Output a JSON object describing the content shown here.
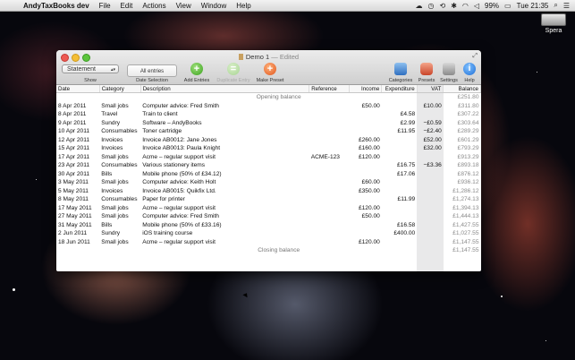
{
  "menubar": {
    "app_name": "AndyTaxBooks dev",
    "items": [
      "File",
      "Edit",
      "Actions",
      "View",
      "Window",
      "Help"
    ],
    "battery": "99%",
    "clock": "Tue 21:35"
  },
  "desktop": {
    "drive_label": "Spera"
  },
  "window": {
    "title": "Demo 1",
    "title_suffix": "— Edited",
    "toolbar": {
      "show_value": "Statement",
      "show_caption": "Show",
      "date_selection_value": "All entries",
      "date_selection_caption": "Date Selection",
      "add_entries": "Add Entries",
      "duplicate_entry": "Duplicate Entry",
      "make_preset": "Make Preset",
      "categories": "Categories",
      "presets": "Presets",
      "settings": "Settings",
      "help": "Help"
    },
    "columns": [
      "Date",
      "Category",
      "Description",
      "Reference",
      "Income",
      "Expenditure",
      "VAT",
      "Balance"
    ],
    "opening": {
      "label": "Opening balance",
      "balance": "£251.80"
    },
    "rows": [
      {
        "date": "8 Apr 2011",
        "category": "Small jobs",
        "description": "Computer advice: Fred Smith",
        "reference": "",
        "income": "£50.00",
        "expenditure": "",
        "vat": "£10.00",
        "balance": "£311.80"
      },
      {
        "date": "8 Apr 2011",
        "category": "Travel",
        "description": "Train to client",
        "reference": "",
        "income": "",
        "expenditure": "£4.58",
        "vat": "",
        "balance": "£307.22"
      },
      {
        "date": "9 Apr 2011",
        "category": "Sundry",
        "description": "Software – AndyBooks",
        "reference": "",
        "income": "",
        "expenditure": "£2.99",
        "vat": "−£0.59",
        "balance": "£303.64"
      },
      {
        "date": "10 Apr 2011",
        "category": "Consumables",
        "description": "Toner cartridge",
        "reference": "",
        "income": "",
        "expenditure": "£11.95",
        "vat": "−£2.40",
        "balance": "£289.29"
      },
      {
        "date": "12 Apr 2011",
        "category": "Invoices",
        "description": "Invoice AB0012: Jane Jones",
        "reference": "",
        "income": "£260.00",
        "expenditure": "",
        "vat": "£52.00",
        "balance": "£601.29"
      },
      {
        "date": "15 Apr 2011",
        "category": "Invoices",
        "description": "Invoice AB0013: Paula Knight",
        "reference": "",
        "income": "£160.00",
        "expenditure": "",
        "vat": "£32.00",
        "balance": "£793.29"
      },
      {
        "date": "17 Apr 2011",
        "category": "Small jobs",
        "description": "Acme – regular support visit",
        "reference": "ACME-123",
        "income": "£120.00",
        "expenditure": "",
        "vat": "",
        "balance": "£913.29"
      },
      {
        "date": "23 Apr 2011",
        "category": "Consumables",
        "description": "Various stationery items",
        "reference": "",
        "income": "",
        "expenditure": "£16.75",
        "vat": "−£3.36",
        "balance": "£893.18"
      },
      {
        "date": "30 Apr 2011",
        "category": "Bills",
        "description": "Mobile phone (50% of £34.12)",
        "reference": "",
        "income": "",
        "expenditure": "£17.06",
        "vat": "",
        "balance": "£876.12"
      },
      {
        "date": "3 May 2011",
        "category": "Small jobs",
        "description": "Computer advice: Keith Holt",
        "reference": "",
        "income": "£60.00",
        "expenditure": "",
        "vat": "",
        "balance": "£936.12"
      },
      {
        "date": "5 May 2011",
        "category": "Invoices",
        "description": "Invoice AB0015: Quikfix Ltd.",
        "reference": "",
        "income": "£350.00",
        "expenditure": "",
        "vat": "",
        "balance": "£1,286.12"
      },
      {
        "date": "8 May 2011",
        "category": "Consumables",
        "description": "Paper for printer",
        "reference": "",
        "income": "",
        "expenditure": "£11.99",
        "vat": "",
        "balance": "£1,274.13"
      },
      {
        "date": "17 May 2011",
        "category": "Small jobs",
        "description": "Acme – regular support visit",
        "reference": "",
        "income": "£120.00",
        "expenditure": "",
        "vat": "",
        "balance": "£1,394.13"
      },
      {
        "date": "27 May 2011",
        "category": "Small jobs",
        "description": "Computer advice: Fred Smith",
        "reference": "",
        "income": "£50.00",
        "expenditure": "",
        "vat": "",
        "balance": "£1,444.13"
      },
      {
        "date": "31 May 2011",
        "category": "Bills",
        "description": "Mobile phone (50% of £33.16)",
        "reference": "",
        "income": "",
        "expenditure": "£16.58",
        "vat": "",
        "balance": "£1,427.55"
      },
      {
        "date": "2 Jun 2011",
        "category": "Sundry",
        "description": "iOS training course",
        "reference": "",
        "income": "",
        "expenditure": "£400.00",
        "vat": "",
        "balance": "£1,027.55"
      },
      {
        "date": "18 Jun 2011",
        "category": "Small jobs",
        "description": "Acme – regular support visit",
        "reference": "",
        "income": "£120.00",
        "expenditure": "",
        "vat": "",
        "balance": "£1,147.55"
      }
    ],
    "closing": {
      "label": "Closing balance",
      "balance": "£1,147.55"
    }
  }
}
